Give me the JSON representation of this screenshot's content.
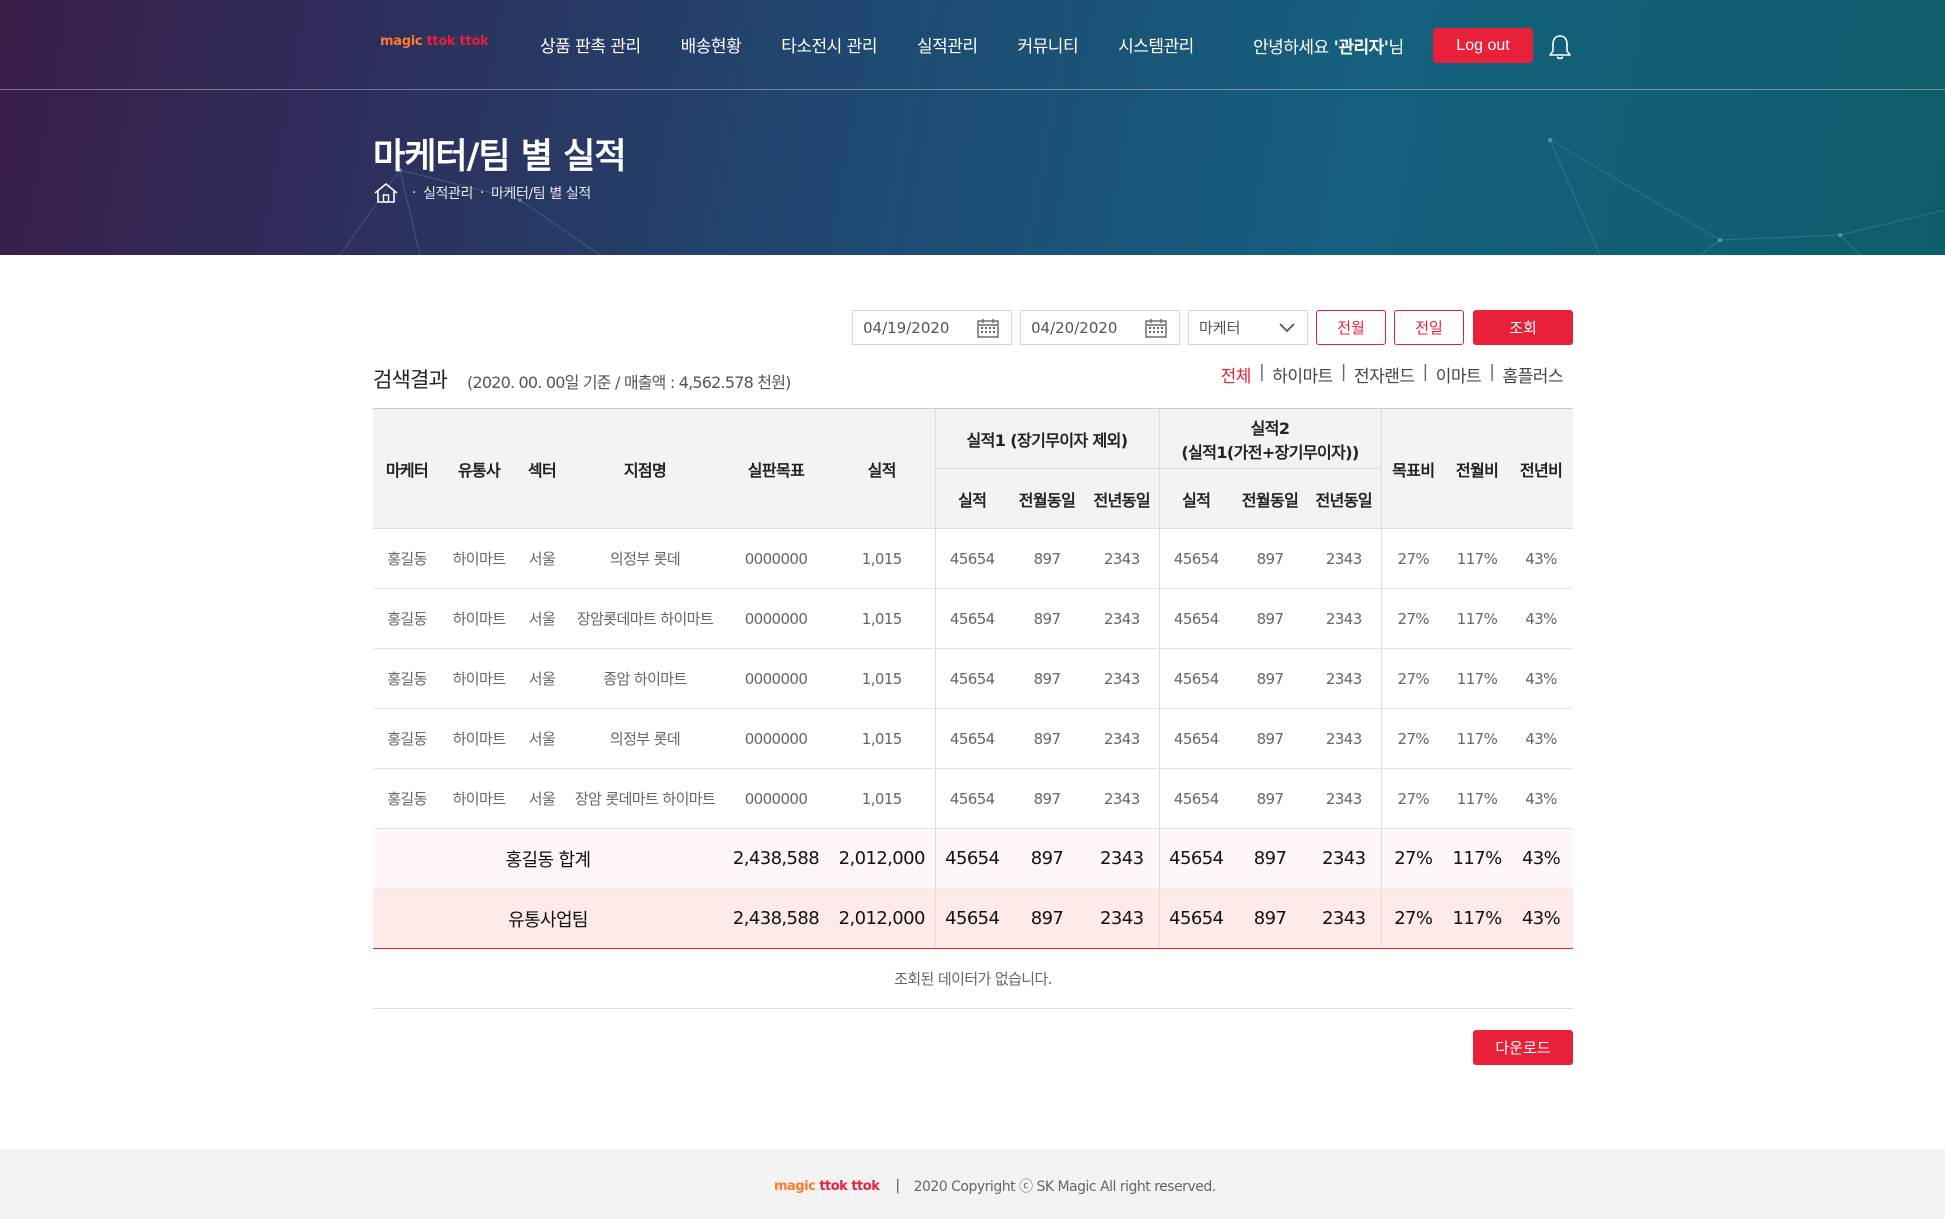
{
  "brand": {
    "logo_part1": "magic ",
    "logo_part2": "ttok ttok",
    "accent": "#e8203a"
  },
  "nav": [
    "상품 판촉 관리",
    "배송현황",
    "타소전시 관리",
    "실적관리",
    "커뮤니티",
    "시스템관리"
  ],
  "user": {
    "greeting_pre": "안녕하세요 ",
    "name": "'관리자'",
    "greeting_post": "님",
    "logout_label": "Log out"
  },
  "page": {
    "title": "마케터/팀 별 실적",
    "breadcrumb": [
      "실적관리",
      "마케터/팀 별 실적"
    ]
  },
  "filter": {
    "date_from": "04/19/2020",
    "date_to": "04/20/2020",
    "select_value": "마케터",
    "prev_month_label": "전월",
    "prev_day_label": "전일",
    "search_label": "조회"
  },
  "result": {
    "title": "검색결과",
    "subtitle": "(2020. 00. 00일 기준 / 매출액 : 4,562.578 천원)",
    "tabs": [
      "전체",
      "하이마트",
      "전자랜드",
      "이마트",
      "홈플러스"
    ],
    "active_tab": 0
  },
  "table": {
    "headers": {
      "marketer": "마케터",
      "distributor": "유통사",
      "sector": "섹터",
      "branch": "지점명",
      "target": "실판목표",
      "perf": "실적",
      "group1": "실적1 (장기무이자 제외)",
      "group2_line1": "실적2",
      "group2_line2": "(실적1(가전+장기무이자))",
      "sub_perf": "실적",
      "sub_mom": "전월동일",
      "sub_yoy": "전년동일",
      "target_ratio": "목표비",
      "mom_ratio": "전월비",
      "yoy_ratio": "전년비"
    },
    "rows": [
      [
        "홍길동",
        "하이마트",
        "서울",
        "의정부 롯데",
        "0000000",
        "1,015",
        "45654",
        "897",
        "2343",
        "45654",
        "897",
        "2343",
        "27%",
        "117%",
        "43%"
      ],
      [
        "홍길동",
        "하이마트",
        "서울",
        "장암롯데마트 하이마트",
        "0000000",
        "1,015",
        "45654",
        "897",
        "2343",
        "45654",
        "897",
        "2343",
        "27%",
        "117%",
        "43%"
      ],
      [
        "홍길동",
        "하이마트",
        "서울",
        "종암 하이마트",
        "0000000",
        "1,015",
        "45654",
        "897",
        "2343",
        "45654",
        "897",
        "2343",
        "27%",
        "117%",
        "43%"
      ],
      [
        "홍길동",
        "하이마트",
        "서울",
        "의정부 롯데",
        "0000000",
        "1,015",
        "45654",
        "897",
        "2343",
        "45654",
        "897",
        "2343",
        "27%",
        "117%",
        "43%"
      ],
      [
        "홍길동",
        "하이마트",
        "서울",
        "장암 롯데마트 하이마트",
        "0000000",
        "1,015",
        "45654",
        "897",
        "2343",
        "45654",
        "897",
        "2343",
        "27%",
        "117%",
        "43%"
      ]
    ],
    "sum_row": [
      "홍길동 합계",
      "2,438,588",
      "2,012,000",
      "45654",
      "897",
      "2343",
      "45654",
      "897",
      "2343",
      "27%",
      "117%",
      "43%"
    ],
    "team_row": [
      "유통사업팀",
      "2,438,588",
      "2,012,000",
      "45654",
      "897",
      "2343",
      "45654",
      "897",
      "2343",
      "27%",
      "117%",
      "43%"
    ],
    "empty_message": "조회된 데이터가 없습니다."
  },
  "download_label": "다운로드",
  "footer": {
    "logo_part1": "magic ",
    "logo_part2": "ttok ttok",
    "separator": "|",
    "copyright": "2020 Copyright ⓒ SK Magic All right reserved."
  }
}
